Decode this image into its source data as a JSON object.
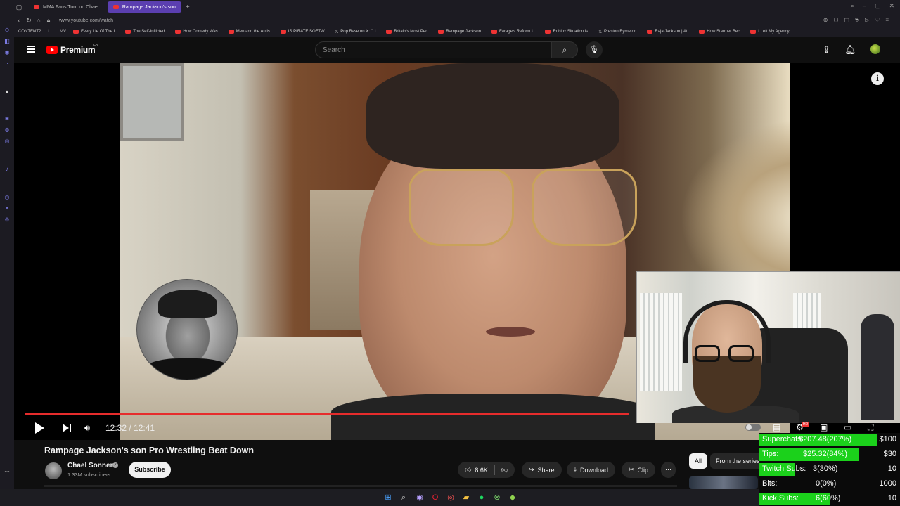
{
  "browser": {
    "tabs": [
      {
        "label": "MMA Fans Turn on Chae",
        "active": false
      },
      {
        "label": "Rampage Jackson's son",
        "active": true
      }
    ],
    "new_tab": "+",
    "url": "www.youtube.com/watch",
    "bookmarks": [
      "CONTENT?",
      "LL",
      "MV",
      "Every Lie Of The I...",
      "The Self-Inflicted...",
      "How Comedy Was...",
      "Men and the Autis...",
      "IS PIRATE SOFTW...",
      "Pop Base on X: \"Li...",
      "Britain's Most Pec...",
      "Rampage Jackson...",
      "Farage's Reform U...",
      "Roblox Situation is...",
      "Preston Byrne on...",
      "Raja Jackson | Att...",
      "How Starmer Bec...",
      "I Left My Agency,..."
    ]
  },
  "youtube": {
    "logo_text": "Premium",
    "logo_region": "GB",
    "search_placeholder": "Search",
    "video": {
      "current_time": "12:32",
      "duration": "12:41",
      "time_display": "12:32 / 12:41",
      "progress": 0.988
    },
    "title": "Rampage Jackson's son Pro Wrestling Beat Down",
    "channel": {
      "name": "Chael Sonnen",
      "subscribers": "1.33M subscribers",
      "subscribe_label": "Subscribe"
    },
    "actions": {
      "likes": "8.6K",
      "share": "Share",
      "download": "Download",
      "clip": "Clip",
      "more": "⋯"
    },
    "chips": {
      "all": "All",
      "series": "From the series"
    }
  },
  "stream_stats": {
    "accent_color": "#1bd11b",
    "rows": [
      {
        "label": "Superchats:",
        "value": "$207.48(207%)",
        "goal": "$100",
        "fill": 1.0
      },
      {
        "label": "Tips:",
        "value": "$25.32(84%)",
        "goal": "$30",
        "fill": 0.84
      },
      {
        "label": "Twitch Subs:",
        "value": "3(30%)",
        "goal": "10",
        "fill": 0.3
      },
      {
        "label": "Bits:",
        "value": "0(0%)",
        "goal": "1000",
        "fill": 0.0
      },
      {
        "label": "Kick Subs:",
        "value": "6(60%)",
        "goal": "10",
        "fill": 0.6
      }
    ]
  },
  "icons": {
    "search": "search-icon",
    "mic": "mic-icon",
    "upload": "upload-icon",
    "bell": "bell-icon",
    "info": "info-icon"
  }
}
